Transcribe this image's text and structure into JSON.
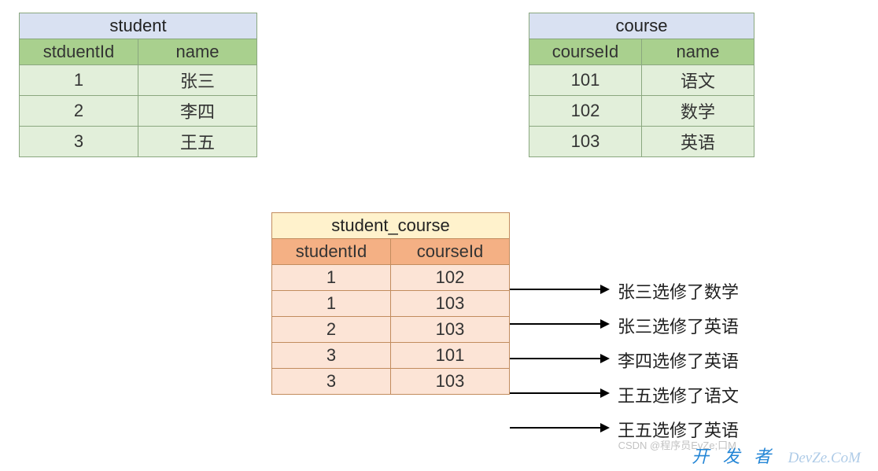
{
  "student": {
    "title": "student",
    "headers": [
      "stduentId",
      "name"
    ],
    "rows": [
      [
        "1",
        "张三"
      ],
      [
        "2",
        "李四"
      ],
      [
        "3",
        "王五"
      ]
    ]
  },
  "course": {
    "title": "course",
    "headers": [
      "courseId",
      "name"
    ],
    "rows": [
      [
        "101",
        "语文"
      ],
      [
        "102",
        "数学"
      ],
      [
        "103",
        "英语"
      ]
    ]
  },
  "student_course": {
    "title": "student_course",
    "headers": [
      "studentId",
      "courseId"
    ],
    "rows": [
      [
        "1",
        "102"
      ],
      [
        "1",
        "103"
      ],
      [
        "2",
        "103"
      ],
      [
        "3",
        "101"
      ],
      [
        "3",
        "103"
      ]
    ]
  },
  "annotations": [
    "张三选修了数学",
    "张三选修了英语",
    "李四选修了英语",
    "王五选修了语文",
    "王五选修了英语"
  ],
  "watermark_dev_kai": "开",
  "watermark_dev_fa": "发",
  "watermark_dev_zhe": "者",
  "watermark_dev_main": "DevZe.CoM",
  "watermark_csdn": "CSDN @程序员EvZe;口M"
}
